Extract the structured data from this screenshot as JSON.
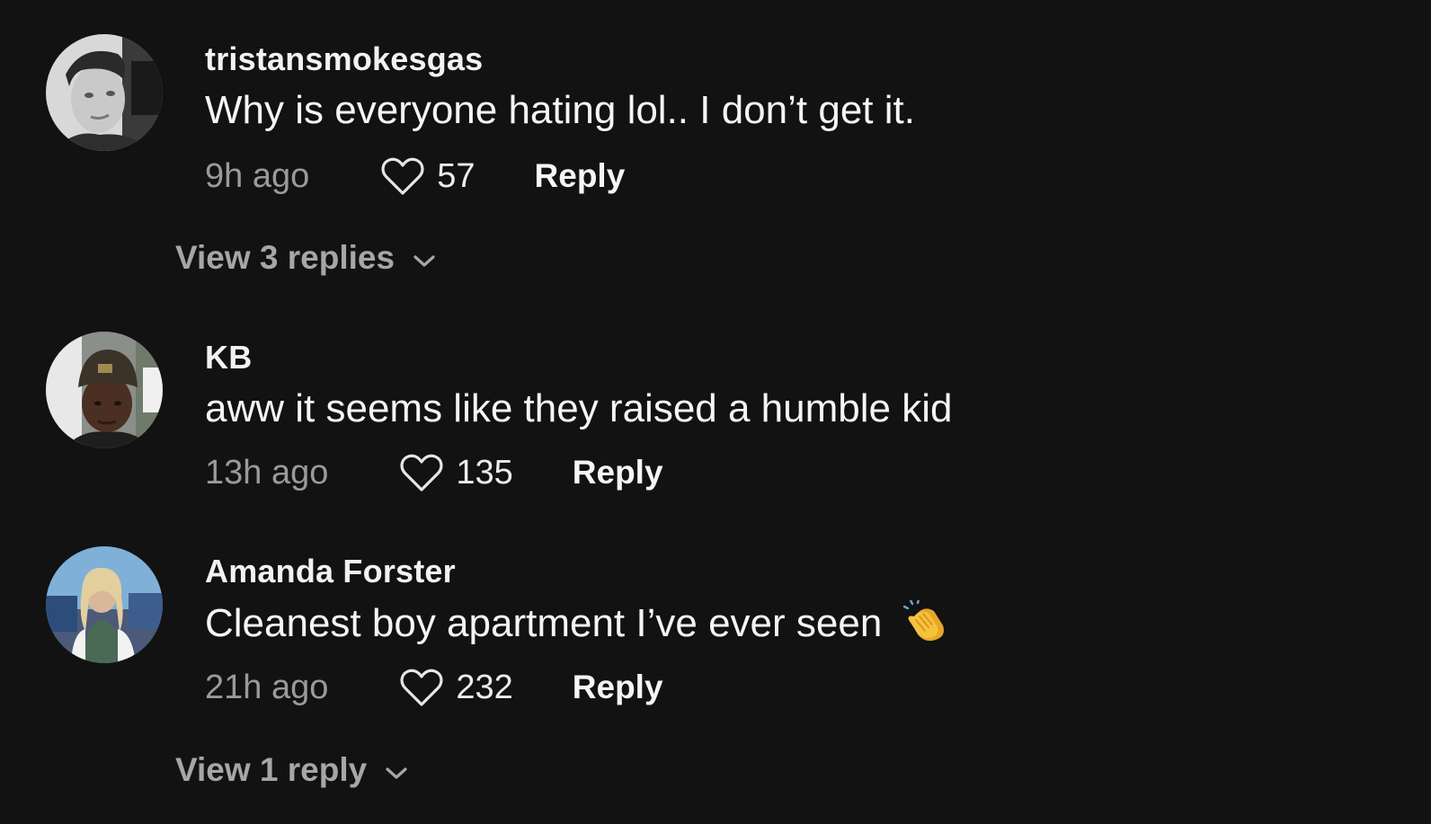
{
  "comments": [
    {
      "username": "tristansmokesgas",
      "text": "Why is everyone hating lol.. I don’t get it.",
      "time": "9h ago",
      "likes": "57",
      "reply_label": "Reply",
      "view_replies": "View 3 replies"
    },
    {
      "username": "KB",
      "text": "aww it seems like they raised a humble kid",
      "time": "13h ago",
      "likes": "135",
      "reply_label": "Reply"
    },
    {
      "username": "Amanda Forster",
      "text": "Cleanest boy apartment I’ve ever seen",
      "emoji": "clapping-hands",
      "time": "21h ago",
      "likes": "232",
      "reply_label": "Reply",
      "view_replies": "View 1 reply"
    }
  ],
  "icons": {
    "like": "heart-outline-icon",
    "expand": "chevron-down-icon"
  },
  "colors": {
    "background": "#121212",
    "username": "#f2f2f2",
    "secondary_text": "#9a9a9a",
    "view_replies": "#a6a6a6"
  }
}
